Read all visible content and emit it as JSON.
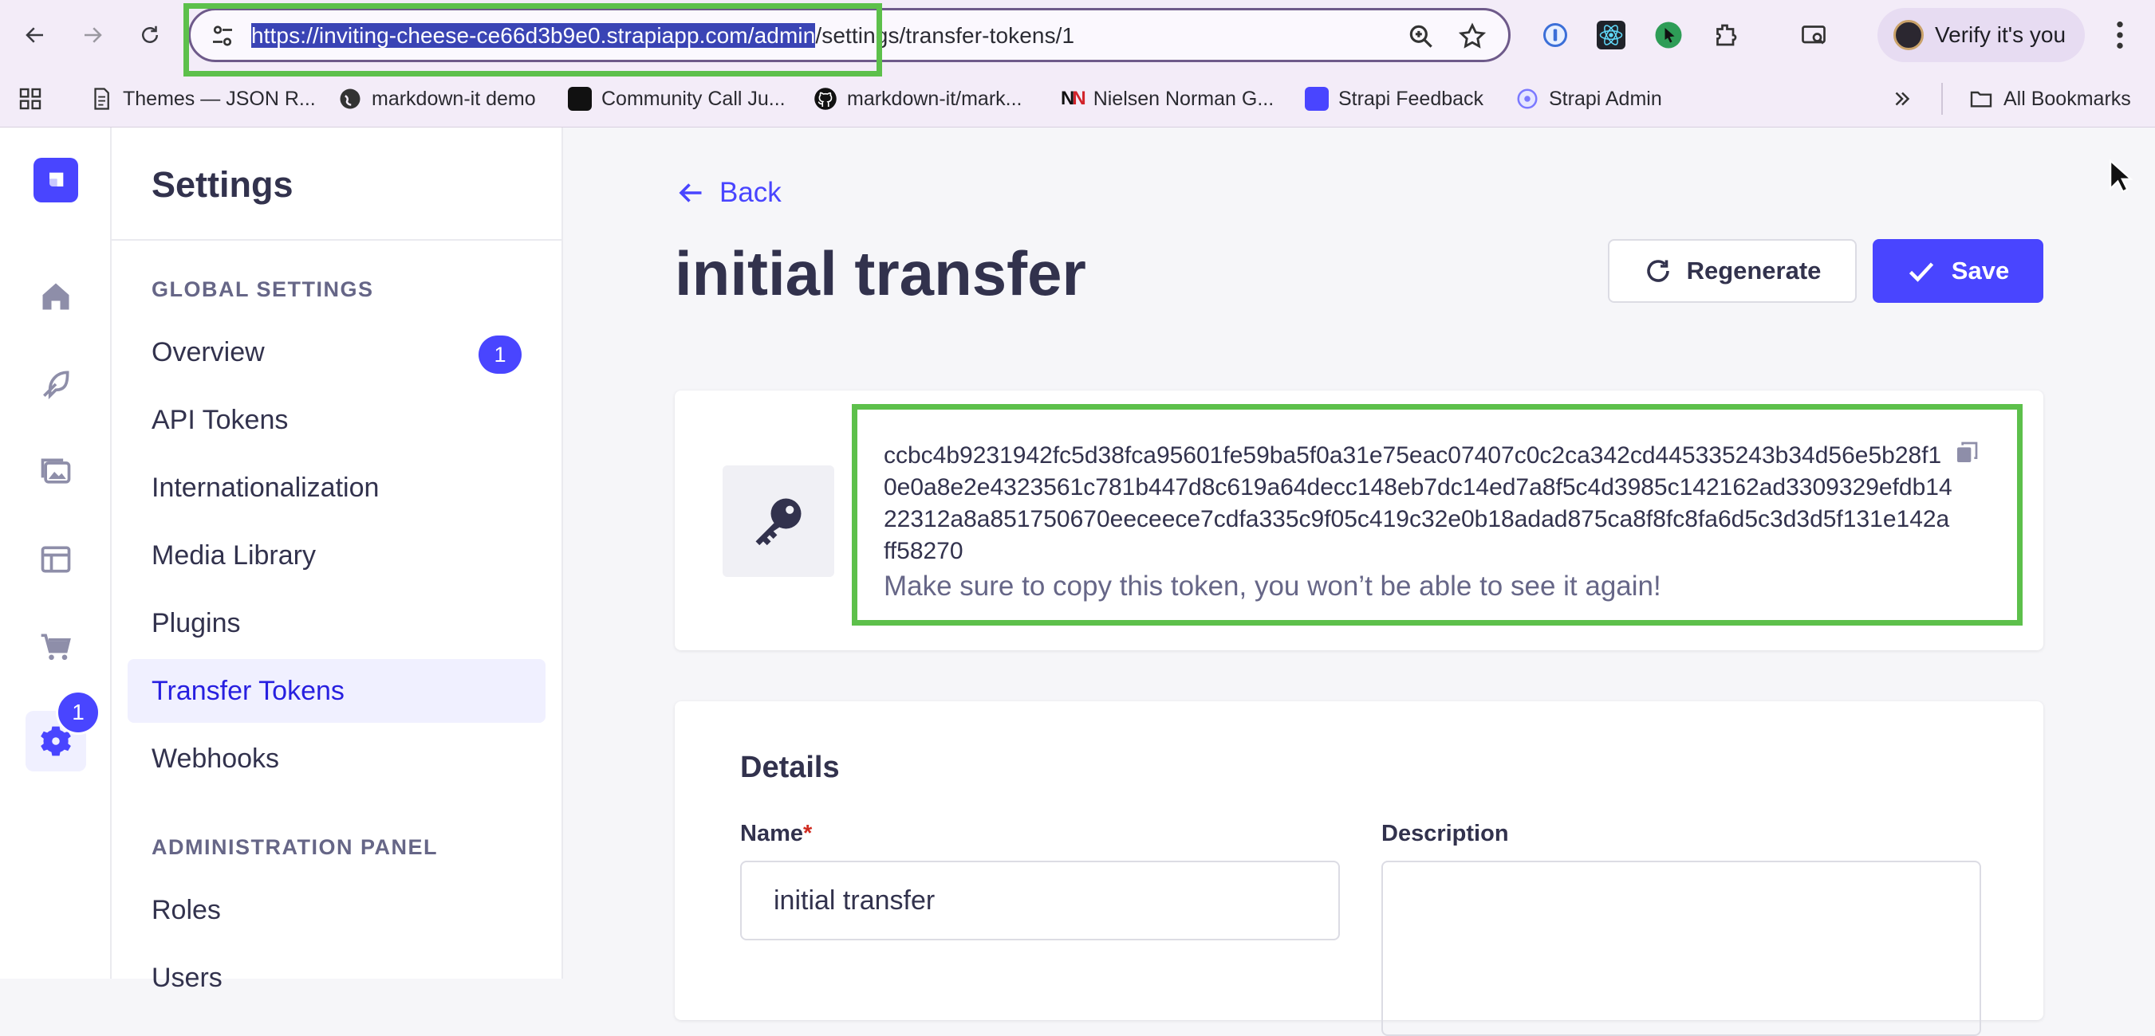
{
  "browser": {
    "url_selected": "https://inviting-cheese-ce66d3b9e0.strapiapp.com/admin",
    "url_rest": "/settings/transfer-tokens/1",
    "verify_label": "Verify it's you",
    "bookmarks": [
      {
        "label": "Themes — JSON R...",
        "icon": "document-icon"
      },
      {
        "label": "markdown-it demo",
        "icon": "globe-icon"
      },
      {
        "label": "Community Call Ju...",
        "icon": "calendar-app-icon"
      },
      {
        "label": "markdown-it/mark...",
        "icon": "github-icon"
      },
      {
        "label": "Nielsen Norman G...",
        "icon": "nng-icon"
      },
      {
        "label": "Strapi Feedback",
        "icon": "strapi-icon"
      },
      {
        "label": "Strapi Admin",
        "icon": "strapi-admin-icon"
      }
    ],
    "all_bookmarks": "All Bookmarks"
  },
  "sidebar": {
    "title": "Settings",
    "sections": [
      {
        "label": "GLOBAL SETTINGS",
        "items": [
          {
            "label": "Overview",
            "badge": "1"
          },
          {
            "label": "API Tokens"
          },
          {
            "label": "Internationalization"
          },
          {
            "label": "Media Library"
          },
          {
            "label": "Plugins"
          },
          {
            "label": "Transfer Tokens",
            "active": true
          },
          {
            "label": "Webhooks"
          }
        ]
      },
      {
        "label": "ADMINISTRATION PANEL",
        "items": [
          {
            "label": "Roles"
          },
          {
            "label": "Users"
          }
        ]
      }
    ]
  },
  "rail": {
    "settings_badge": "1"
  },
  "page": {
    "back_label": "Back",
    "title": "initial transfer",
    "regenerate_label": "Regenerate",
    "save_label": "Save"
  },
  "token": {
    "value": "ccbc4b9231942fc5d38fca95601fe59ba5f0a31e75eac07407c0c2ca342cd445335243b34d56e5b28f10e0a8e2e4323561c781b447d8c619a64decc148eb7dc14ed7a8f5c4d3985c142162ad3309329efdb1422312a8a851750670eeceece7cdfa335c9f05c419c32e0b18adad875ca8f8fc8fa6d5c3d3d5f131e142aff58270",
    "hint": "Make sure to copy this token, you won’t be able to see it again!"
  },
  "details": {
    "title": "Details",
    "name_label": "Name",
    "name_required": "*",
    "name_value": "initial transfer",
    "description_label": "Description",
    "description_value": ""
  },
  "colors": {
    "primary": "#4945ff",
    "highlight": "#5dc04b",
    "active_text": "#271fe0"
  }
}
